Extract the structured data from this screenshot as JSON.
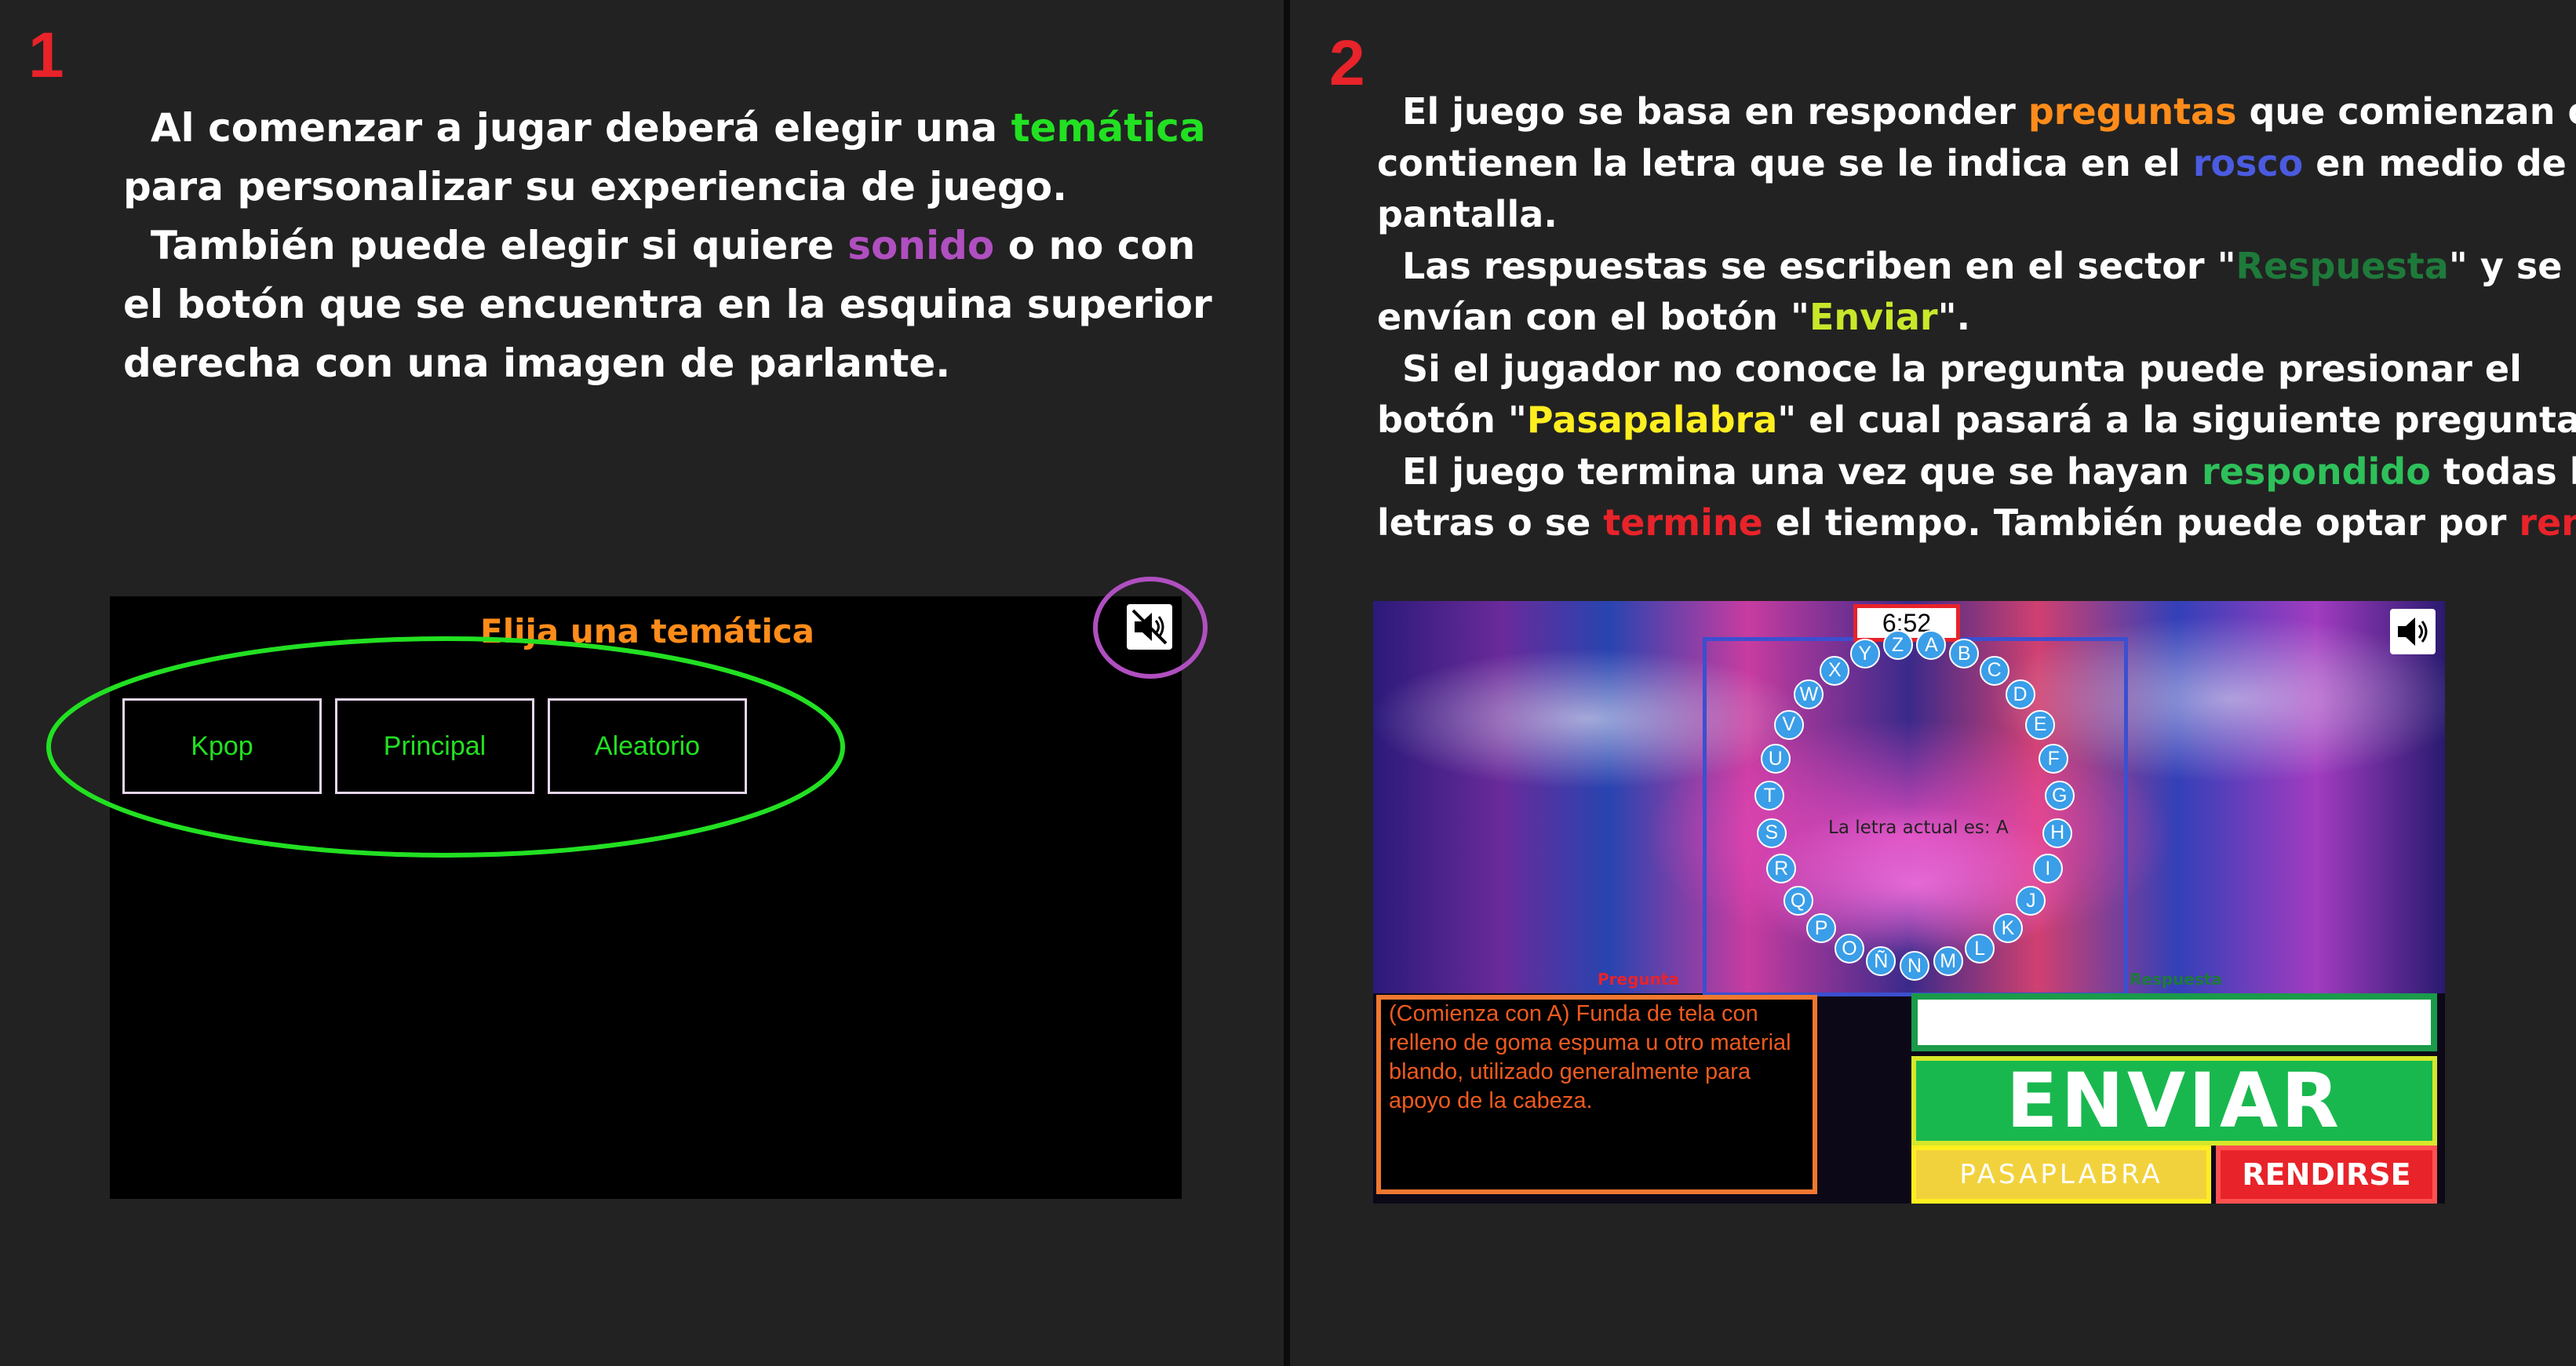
{
  "colors": {
    "background": "#222222",
    "step_number": "#e8232a",
    "tematica": "#22e022",
    "sonido": "#b04fc0",
    "preguntas": "#ff8c1a",
    "rosco": "#4a5be0",
    "respuesta": "#1e7a3a",
    "enviar": "#c8e82a",
    "pasapalabra": "#ffee20",
    "respondido": "#2ec05a",
    "termine": "#e8232a",
    "rendirse": "#e8232a",
    "highlight_green_ellipse": "#22e022",
    "highlight_purple_circle": "#b04fc0"
  },
  "panel1": {
    "number": "1",
    "text": {
      "l1a": "Al comenzar a jugar deberá elegir una ",
      "l1b": "temática",
      "l2": "para personalizar su experiencia de juego.",
      "l3a": "También puede elegir si quiere ",
      "l3b": "sonido",
      "l3c": " o no con",
      "l4": "el botón que se encuentra en la esquina superior",
      "l5": "derecha con una imagen de parlante."
    },
    "screen": {
      "title": "Elija una temática",
      "themes": [
        "Kpop",
        "Principal",
        "Aleatorio"
      ],
      "sound_icon": "speaker-muted-icon"
    }
  },
  "panel2": {
    "number": "2",
    "text": {
      "l1a": "El juego se basa en responder ",
      "l1b": "preguntas",
      "l1c": " que comienzan o",
      "l2a": "contienen la letra que se le indica en el ",
      "l2b": "rosco",
      "l2c": " en medio de la",
      "l3": "pantalla.",
      "l4a": "Las respuestas se escriben en el sector \"",
      "l4b": "Respuesta",
      "l4c": "\" y se",
      "l5a": "envían con el botón \"",
      "l5b": "Enviar",
      "l5c": "\".",
      "l6": "Si el jugador no conoce la pregunta puede presionar el",
      "l7a": "botón \"",
      "l7b": "Pasapalabra",
      "l7c": "\" el cual pasará a la siguiente pregunta.",
      "l8a": "El juego termina una vez que se hayan ",
      "l8b": "respondido",
      "l8c": " todas las",
      "l9a": "letras o se ",
      "l9b": "termine",
      "l9c": " el tiempo. También puede optar por ",
      "l9d": "rendirse",
      "l9e": "."
    },
    "screen": {
      "timer": "6:52",
      "sound_icon": "speaker-icon",
      "letters": [
        "A",
        "B",
        "C",
        "D",
        "E",
        "F",
        "G",
        "H",
        "I",
        "J",
        "K",
        "L",
        "M",
        "N",
        "Ñ",
        "O",
        "P",
        "Q",
        "R",
        "S",
        "T",
        "U",
        "V",
        "W",
        "X",
        "Y",
        "Z"
      ],
      "current_letter": "La letra actual es: A",
      "pregunta_label": "Pregunta",
      "respuesta_label": "Respuesta",
      "question_text": "(Comienza con A) Funda de tela con relleno de goma espuma u otro material blando, utilizado generalmente para apoyo de la cabeza.",
      "answer_value": "",
      "enviar_label": "ENVIAR",
      "pasapalabra_label": "PASAPLABRA",
      "rendirse_label": "RENDIRSE"
    }
  }
}
